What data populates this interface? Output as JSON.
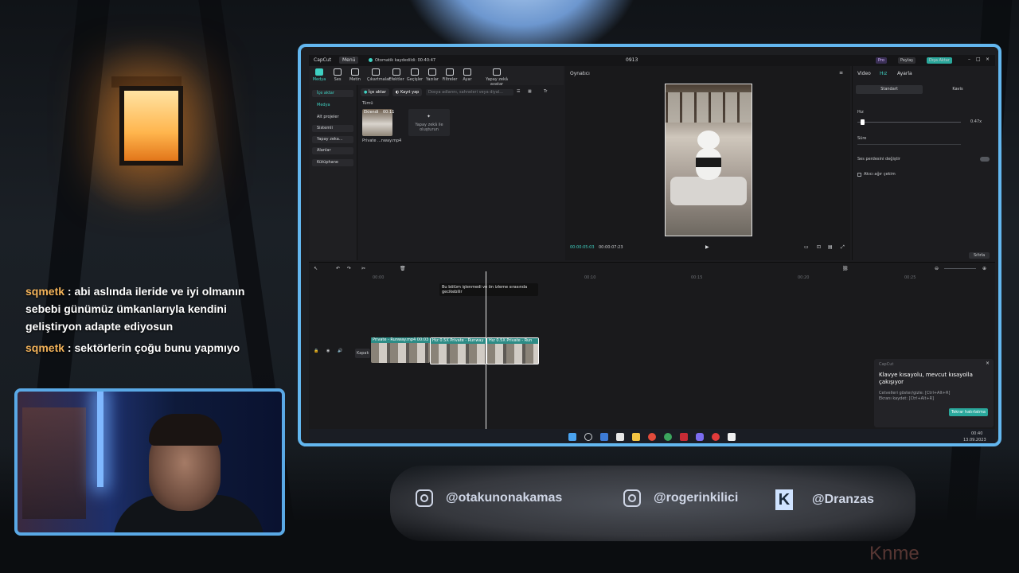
{
  "chat": [
    {
      "user": "sqmetk",
      "message": " : abi aslında ileride ve iyi olmanın sebebi günümüz ümkanlarıyla kendini geliştiryon adapte ediyosun"
    },
    {
      "user": "sqmetk",
      "message": " : sektörlerin çoğu bunu yapmıyo"
    }
  ],
  "socials": [
    {
      "icon": "instagram-icon",
      "handle": "@otakunonakamas"
    },
    {
      "icon": "instagram-icon",
      "handle": "@rogerinkilici"
    },
    {
      "icon": "kick-icon",
      "handle": "@Dranzas"
    }
  ],
  "watermark": "Knme",
  "app": {
    "brand": "CapCut",
    "menu_label": "Menü",
    "autosave": "Otomatik kaydedildi: 00:40:47",
    "project_title": "0913",
    "pro_label": "Pro",
    "share_label": "Paylaş",
    "export_label": "Dışa Aktar",
    "toolbar": [
      "Medya",
      "Ses",
      "Metin",
      "Çıkartmalar",
      "Efektler",
      "Geçişler",
      "Yazılar",
      "Filtreler",
      "Ayar",
      "Yapay zekâ avatar"
    ],
    "sidebar": [
      "İçe aktar",
      "Medya",
      "Alt projeler",
      "Sistemli",
      "Yapay zeka...",
      "Alanlar",
      "Kütüphane"
    ],
    "import_button": "İçe aktar",
    "record_button": "Kayıt yap",
    "search_placeholder": "Dosya adlarını, sahneleri veya diyal...",
    "filter_all": "Tümü",
    "media_added": "Eklendi",
    "media_duration": "00:11",
    "media_file": "Private ...nway.mp4",
    "ai_create": "Yapay zekâ ile oluşturun",
    "player_title": "Oynatıcı",
    "time_current": "00:00:05:03",
    "time_total": "00:00:07:23",
    "props_tabs": [
      "Video",
      "Hız",
      "Ayarla"
    ],
    "speed_tabs": [
      "Standart",
      "Kavis"
    ],
    "speed_label": "Hız",
    "speed_value": "0.47x",
    "duration_label": "Süre",
    "pitch_label": "Ses perdesini değiştir",
    "smooth_label": "Akıcı ağır çekim",
    "reset_label": "Sıfırla",
    "timeline_tooltip": "Bu bölüm işlenmedi ve ön izleme sırasında gecikebilir",
    "ruler": [
      "00:00",
      "00:10",
      "00:15",
      "00:20",
      "00:25"
    ],
    "clips": [
      "Private - Runway.mp4 00:03",
      "Hız 0.5X  Private - Runway",
      "Hız 0.5X  Private - Run"
    ],
    "cover_label": "Kapak",
    "toast_app": "CapCut",
    "toast_title": "Klavye kısayolu, mevcut kısayolla çakışıyor",
    "toast_line1": "Cetvelleri göster/gizle: [Ctrl+Alt+R]",
    "toast_line2": "Ekranı kaydet: [Ctrl+Alt+R]",
    "toast_button": "Tekrar hatırlatma",
    "clock_time": "00:40",
    "clock_date": "13.09.2023"
  }
}
